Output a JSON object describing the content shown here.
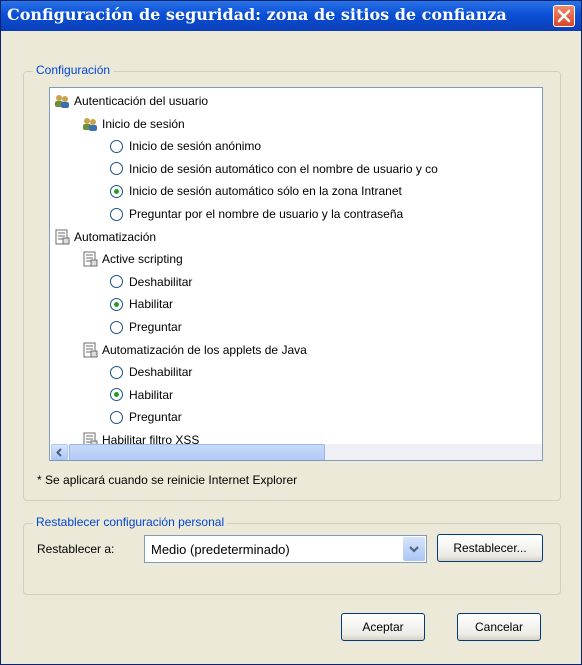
{
  "window": {
    "title": "Configuración de seguridad: zona de sitios de confianza"
  },
  "settings_group": {
    "legend": "Configuración",
    "items": [
      {
        "kind": "category",
        "icon": "users-icon",
        "label": "Autenticación del usuario"
      },
      {
        "kind": "category",
        "icon": "users-icon",
        "label": "Inicio de sesión"
      },
      {
        "kind": "option",
        "selected": false,
        "label": "Inicio de sesión anónimo"
      },
      {
        "kind": "option",
        "selected": false,
        "label": "Inicio de sesión automático con el nombre de usuario y co"
      },
      {
        "kind": "option",
        "selected": true,
        "label": "Inicio de sesión automático sólo en la zona Intranet"
      },
      {
        "kind": "option",
        "selected": false,
        "label": "Preguntar por el nombre de usuario y la contraseña"
      },
      {
        "kind": "category",
        "icon": "script-icon",
        "label": "Automatización"
      },
      {
        "kind": "category",
        "icon": "script-icon",
        "label": "Active scripting"
      },
      {
        "kind": "option",
        "selected": false,
        "label": "Deshabilitar"
      },
      {
        "kind": "option",
        "selected": true,
        "label": "Habilitar"
      },
      {
        "kind": "option",
        "selected": false,
        "label": "Preguntar"
      },
      {
        "kind": "category",
        "icon": "script-icon",
        "label": "Automatización de los applets de Java"
      },
      {
        "kind": "option",
        "selected": false,
        "label": "Deshabilitar"
      },
      {
        "kind": "option",
        "selected": true,
        "label": "Habilitar"
      },
      {
        "kind": "option",
        "selected": false,
        "label": "Preguntar"
      },
      {
        "kind": "category",
        "icon": "script-icon",
        "label": "Habilitar filtro XSS"
      }
    ]
  },
  "restart_note": "* Se aplicará cuando se reinicie Internet Explorer",
  "reset_group": {
    "legend": "Restablecer configuración personal",
    "label": "Restablecer a:",
    "selected_value": "Medio (predeterminado)",
    "reset_button": "Restablecer..."
  },
  "buttons": {
    "ok": "Aceptar",
    "cancel": "Cancelar"
  },
  "colors": {
    "titlebar": "#0a4fd6",
    "legend_text": "#0046d5",
    "radio_selected": "#21a121"
  }
}
